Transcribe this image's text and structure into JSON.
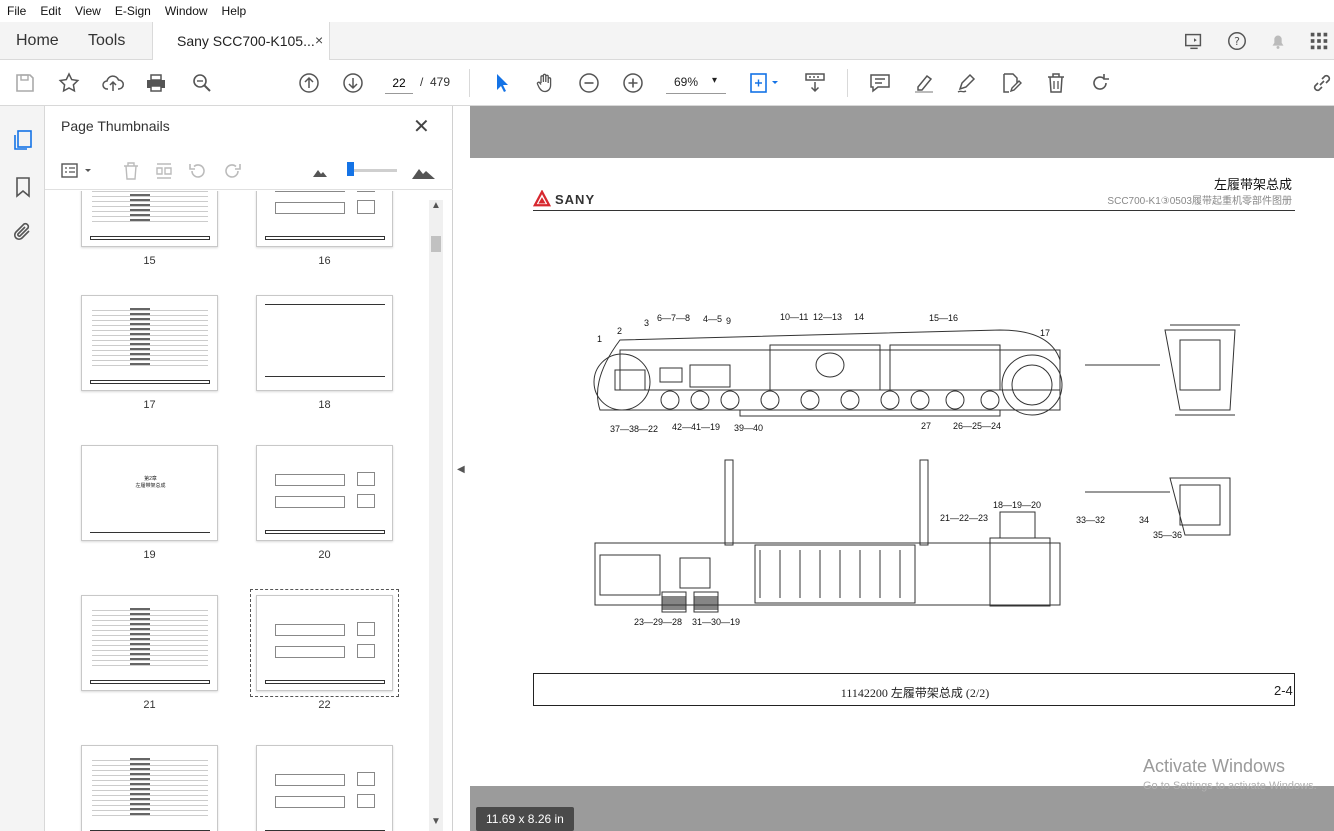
{
  "menu": [
    "File",
    "Edit",
    "View",
    "E-Sign",
    "Window",
    "Help"
  ],
  "tabs": {
    "home": "Home",
    "tools": "Tools",
    "document": "Sany SCC700-K105...",
    "close": "×"
  },
  "toolbar": {
    "page_current": "22",
    "page_separator": "/",
    "page_total": "479",
    "zoom": "69%",
    "zoom_caret": "▾"
  },
  "panel": {
    "title": "Page Thumbnails",
    "close": "✕"
  },
  "thumbnails": [
    {
      "label": "15"
    },
    {
      "label": "16"
    },
    {
      "label": "17"
    },
    {
      "label": "18"
    },
    {
      "label": "19"
    },
    {
      "label": "20"
    },
    {
      "label": "21"
    },
    {
      "label": "22"
    },
    {
      "label": ""
    },
    {
      "label": ""
    }
  ],
  "thumbnail_19_text": {
    "line1": "第2章",
    "line2": "左履带架总成"
  },
  "document": {
    "brand": "SANY",
    "title_cn": "左履带架总成",
    "subtitle": "SCC700-K1③0503履带起重机零部件图册",
    "footer": "11142200  左履带架总成  (2/2)",
    "page_number": "2-4",
    "page_size": "11.69 x 8.26 in",
    "callouts": [
      "1",
      "2",
      "3",
      "6—7—8",
      "4—5",
      "9",
      "10—11",
      "12—13",
      "14",
      "15—16",
      "17",
      "37—38—22",
      "42—41—19",
      "39—40",
      "27",
      "26—25—24",
      "18—19—20",
      "21—22—23",
      "33—32",
      "34",
      "35—36",
      "23—29—28",
      "31—30—19"
    ]
  },
  "watermark": {
    "line1": "Activate Windows",
    "line2": "Go to Settings to activate Windows."
  },
  "colors": {
    "accent": "#1473e6",
    "brand": "#d7282f",
    "doc_bg": "#9b9b9b"
  }
}
